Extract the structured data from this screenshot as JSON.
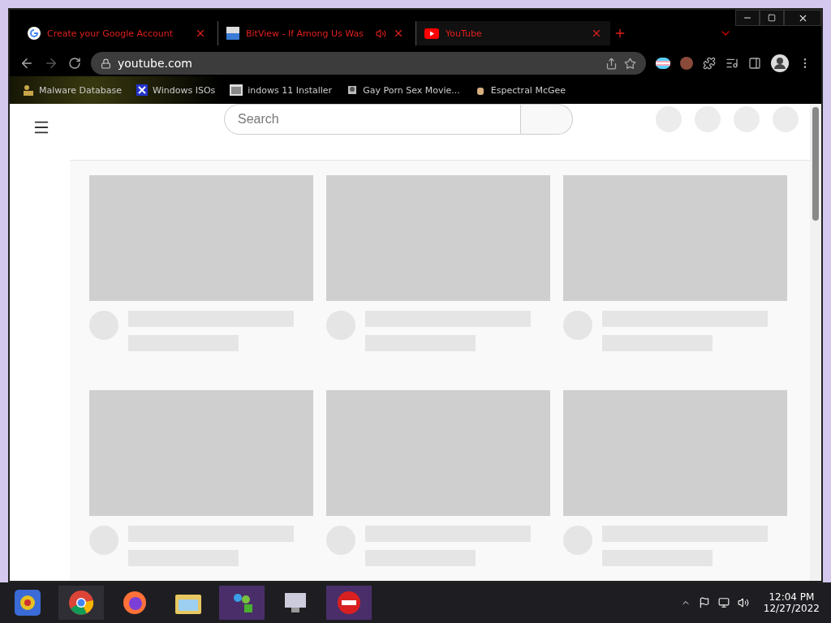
{
  "browser": {
    "tabs": [
      {
        "title": "Create your Google Account",
        "selected": false,
        "audio": false
      },
      {
        "title": "BitView - If Among Us Was",
        "selected": false,
        "audio": true
      },
      {
        "title": "YouTube",
        "selected": true,
        "audio": false
      }
    ],
    "address": "youtube.com",
    "bookmarks": [
      {
        "title": "Malware Database"
      },
      {
        "title": "Windows ISOs"
      },
      {
        "title": "indows 11 Installer"
      },
      {
        "title": "Gay Porn Sex Movie..."
      },
      {
        "title": "Espectral McGee"
      }
    ]
  },
  "page": {
    "search": {
      "placeholder": "Search"
    },
    "cards": [
      {
        "kind": "skeleton"
      },
      {
        "kind": "skeleton"
      },
      {
        "kind": "skeleton"
      },
      {
        "kind": "skeleton"
      },
      {
        "kind": "skeleton"
      },
      {
        "kind": "skeleton"
      }
    ]
  },
  "taskbar": {
    "time": "12:04 PM",
    "date": "12/27/2022"
  }
}
